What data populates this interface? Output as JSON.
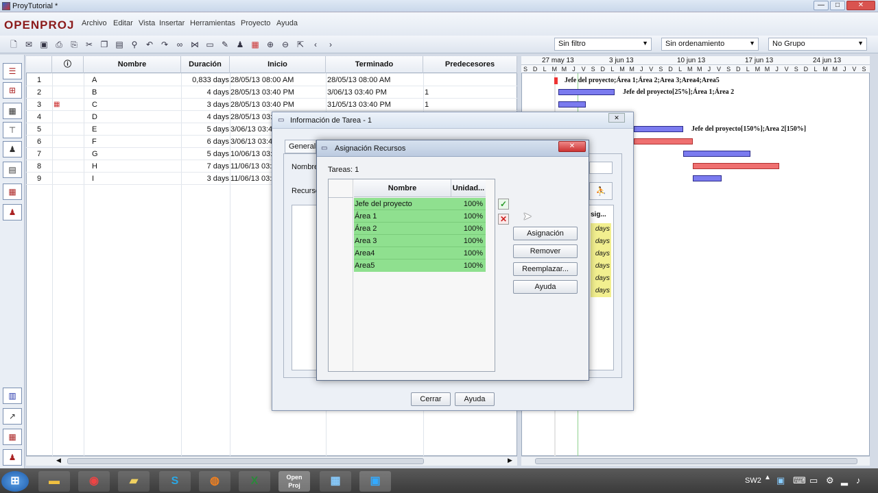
{
  "window": {
    "title": "ProyTutorial *",
    "min": "—",
    "max": "□",
    "close": "✕"
  },
  "app": {
    "logo": "OPENPROJ",
    "menus": [
      "Archivo",
      "Editar",
      "Vista",
      "Insertar",
      "Herramientas",
      "Proyecto",
      "Ayuda"
    ]
  },
  "toolbar": {
    "filter": "Sin filtro",
    "sort": "Sin ordenamiento",
    "group": "No Grupo"
  },
  "table": {
    "columns": [
      "Nombre",
      "Duración",
      "Inicio",
      "Terminado",
      "Predecesores"
    ],
    "rows": [
      {
        "id": "1",
        "name": "A",
        "duration": "0,833 days",
        "start": "28/05/13 08:00 AM",
        "finish": "28/05/13 08:00 AM",
        "pred": ""
      },
      {
        "id": "2",
        "name": "B",
        "duration": "4 days",
        "start": "28/05/13 03:40 PM",
        "finish": "3/06/13 03:40 PM",
        "pred": "1"
      },
      {
        "id": "3",
        "name": "C",
        "duration": "3 days",
        "start": "28/05/13 03:40 PM",
        "finish": "31/05/13 03:40 PM",
        "pred": "1"
      },
      {
        "id": "4",
        "name": "D",
        "duration": "4 days",
        "start": "28/05/13 03:",
        "finish": "",
        "pred": ""
      },
      {
        "id": "5",
        "name": "E",
        "duration": "5 days",
        "start": "3/06/13 03:4",
        "finish": "",
        "pred": ""
      },
      {
        "id": "6",
        "name": "F",
        "duration": "6 days",
        "start": "3/06/13 03:4",
        "finish": "",
        "pred": ""
      },
      {
        "id": "7",
        "name": "G",
        "duration": "5 days",
        "start": "10/06/13 03:4",
        "finish": "",
        "pred": ""
      },
      {
        "id": "8",
        "name": "H",
        "duration": "7 days",
        "start": "11/06/13 03:4",
        "finish": "",
        "pred": ""
      },
      {
        "id": "9",
        "name": "I",
        "duration": "3 days",
        "start": "11/06/13 03:4",
        "finish": "",
        "pred": ""
      }
    ]
  },
  "gantt": {
    "weeks": [
      "27 may 13",
      "3 jun 13",
      "10 jun 13",
      "17 jun 13",
      "24 jun 13"
    ],
    "days": [
      "S",
      "D",
      "L",
      "M",
      "M",
      "J",
      "V"
    ],
    "labels": [
      "Jefe del proyecto;Área 1;Área 2;Area 3;Area4;Area5",
      "Jefe del proyecto[25%];Área 1;Área 2",
      "Jefe del proyecto[150%];Area 2[150%]"
    ]
  },
  "task_dialog": {
    "title": "Información de Tarea - 1",
    "tab_general": "General",
    "label_name": "Nombre",
    "label_resources": "Recurso",
    "close_button": "Cerrar",
    "help_button": "Ayuda",
    "days_values": [
      "days",
      "days",
      "days",
      "days",
      "days",
      "days"
    ],
    "col_partial": "sig..."
  },
  "assign_dialog": {
    "title": "Asignación Recursos",
    "tasks_label": "Tareas: 1",
    "col_name": "Nombre",
    "col_units": "Unidad...",
    "resources": [
      {
        "name": "Jefe del proyecto",
        "units": "100%"
      },
      {
        "name": "Área 1",
        "units": "100%"
      },
      {
        "name": "Área 2",
        "units": "100%"
      },
      {
        "name": "Area 3",
        "units": "100%"
      },
      {
        "name": "Area4",
        "units": "100%"
      },
      {
        "name": "Area5",
        "units": "100%"
      }
    ],
    "buttons": {
      "assign": "Asignación",
      "remove": "Remover",
      "replace": "Reemplazar...",
      "help": "Ayuda"
    },
    "close": "✕"
  },
  "taskbar": {
    "tray_text": "SW2"
  }
}
